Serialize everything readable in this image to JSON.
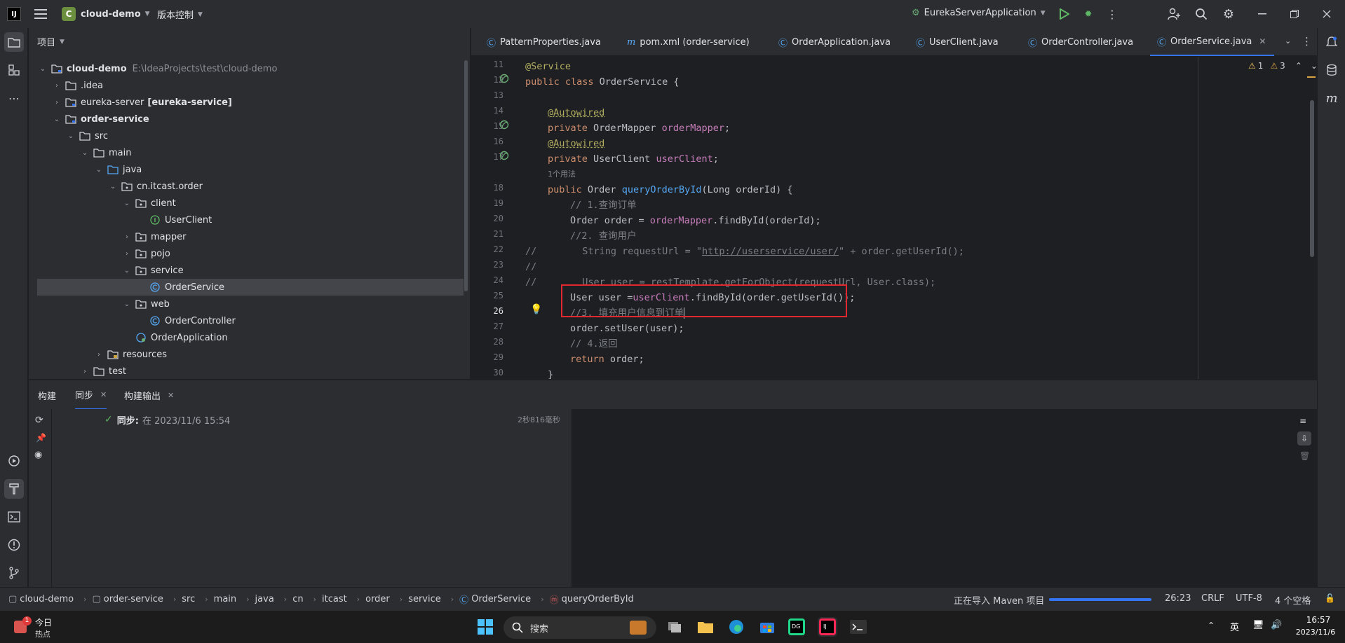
{
  "titlebar": {
    "project_badge": "C",
    "project_name": "cloud-demo",
    "vcs_label": "版本控制",
    "run_config": "EurekaServerApplication"
  },
  "project_panel": {
    "title": "项目",
    "tree": [
      {
        "label": "cloud-demo",
        "extra": "E:\\IdeaProjects\\test\\cloud-demo",
        "bold": true
      },
      {
        "label": ".idea"
      },
      {
        "label": "eureka-server",
        "extra": "[eureka-service]"
      },
      {
        "label": "order-service",
        "bold": true
      },
      {
        "label": "src"
      },
      {
        "label": "main"
      },
      {
        "label": "java"
      },
      {
        "label": "cn.itcast.order"
      },
      {
        "label": "client"
      },
      {
        "label": "UserClient"
      },
      {
        "label": "mapper"
      },
      {
        "label": "pojo"
      },
      {
        "label": "service"
      },
      {
        "label": "OrderService"
      },
      {
        "label": "web"
      },
      {
        "label": "OrderController"
      },
      {
        "label": "OrderApplication"
      },
      {
        "label": "resources"
      },
      {
        "label": "test"
      }
    ]
  },
  "editor": {
    "tabs": [
      {
        "label": "PatternProperties.java"
      },
      {
        "label": "pom.xml (order-service)"
      },
      {
        "label": "OrderApplication.java"
      },
      {
        "label": "UserClient.java"
      },
      {
        "label": "OrderController.java"
      },
      {
        "label": "OrderService.java"
      }
    ],
    "warnings": "1",
    "weak_warnings": "3",
    "usage_hint": "1个用法",
    "lines": [
      "11",
      "12",
      "13",
      "14",
      "15",
      "16",
      "17",
      "18",
      "19",
      "20",
      "21",
      "22",
      "23",
      "24",
      "25",
      "26",
      "27",
      "28",
      "29",
      "30"
    ],
    "code": {
      "l11": "@Service",
      "l12_kw": "public class ",
      "l12_name": "OrderService {",
      "l14": "@Autowired",
      "l15_kw": "private ",
      "l15_type": "OrderMapper ",
      "l15_fld": "orderMapper",
      "l15_end": ";",
      "l16": "@Autowired",
      "l17_kw": "private ",
      "l17_type": "UserClient ",
      "l17_fld": "userClient",
      "l17_end": ";",
      "l18_kw": "public ",
      "l18_type": "Order ",
      "l18_fn": "queryOrderById",
      "l18_end": "(Long orderId) {",
      "l19": "// 1.查询订单",
      "l20_a": "Order order = ",
      "l20_fld": "orderMapper",
      "l20_b": ".findById(orderId);",
      "l21": "//2. 查询用户",
      "l22_cm": "//",
      "l22_a": "        String requestUrl = \"",
      "l22_url": "http://userservice/user/",
      "l22_b": "\" + order.getUserId();",
      "l23_cm": "//",
      "l24_cm": "//",
      "l24_a": "        User user = restTemplate.getForObject(requestUrl, User.class);",
      "l25_a": "User user =",
      "l25_fld": "userClient",
      "l25_b": ".findById(order.getUserId());",
      "l26": "//3. 填充用户信息到订单",
      "l27": "order.setUser(user);",
      "l28": "// 4.返回",
      "l29_kw": "return ",
      "l29_b": "order;",
      "l30": "}"
    }
  },
  "bottom_panel": {
    "tabs": [
      {
        "label": "构建"
      },
      {
        "label": "同步"
      },
      {
        "label": "构建输出"
      }
    ],
    "sync_status": "同步:",
    "sync_time": "在 2023/11/6 15:54",
    "sync_duration": "2秒816毫秒"
  },
  "statusbar": {
    "breadcrumbs": [
      "cloud-demo",
      "order-service",
      "src",
      "main",
      "java",
      "cn",
      "itcast",
      "order",
      "service",
      "OrderService",
      "queryOrderById"
    ],
    "progress_label": "正在导入 Maven 项目",
    "progress": 1.0,
    "position": "26:23",
    "line_sep": "CRLF",
    "encoding": "UTF-8",
    "indent": "4 个空格"
  },
  "taskbar": {
    "news_title": "今日",
    "news_sub": "热点",
    "news_badge": "1",
    "search_label": "搜索",
    "ime": "英",
    "time": "16:57",
    "date": "2023/11/6"
  },
  "colors": {
    "accent": "#3574f0",
    "highlight_box": "#e0282e"
  }
}
